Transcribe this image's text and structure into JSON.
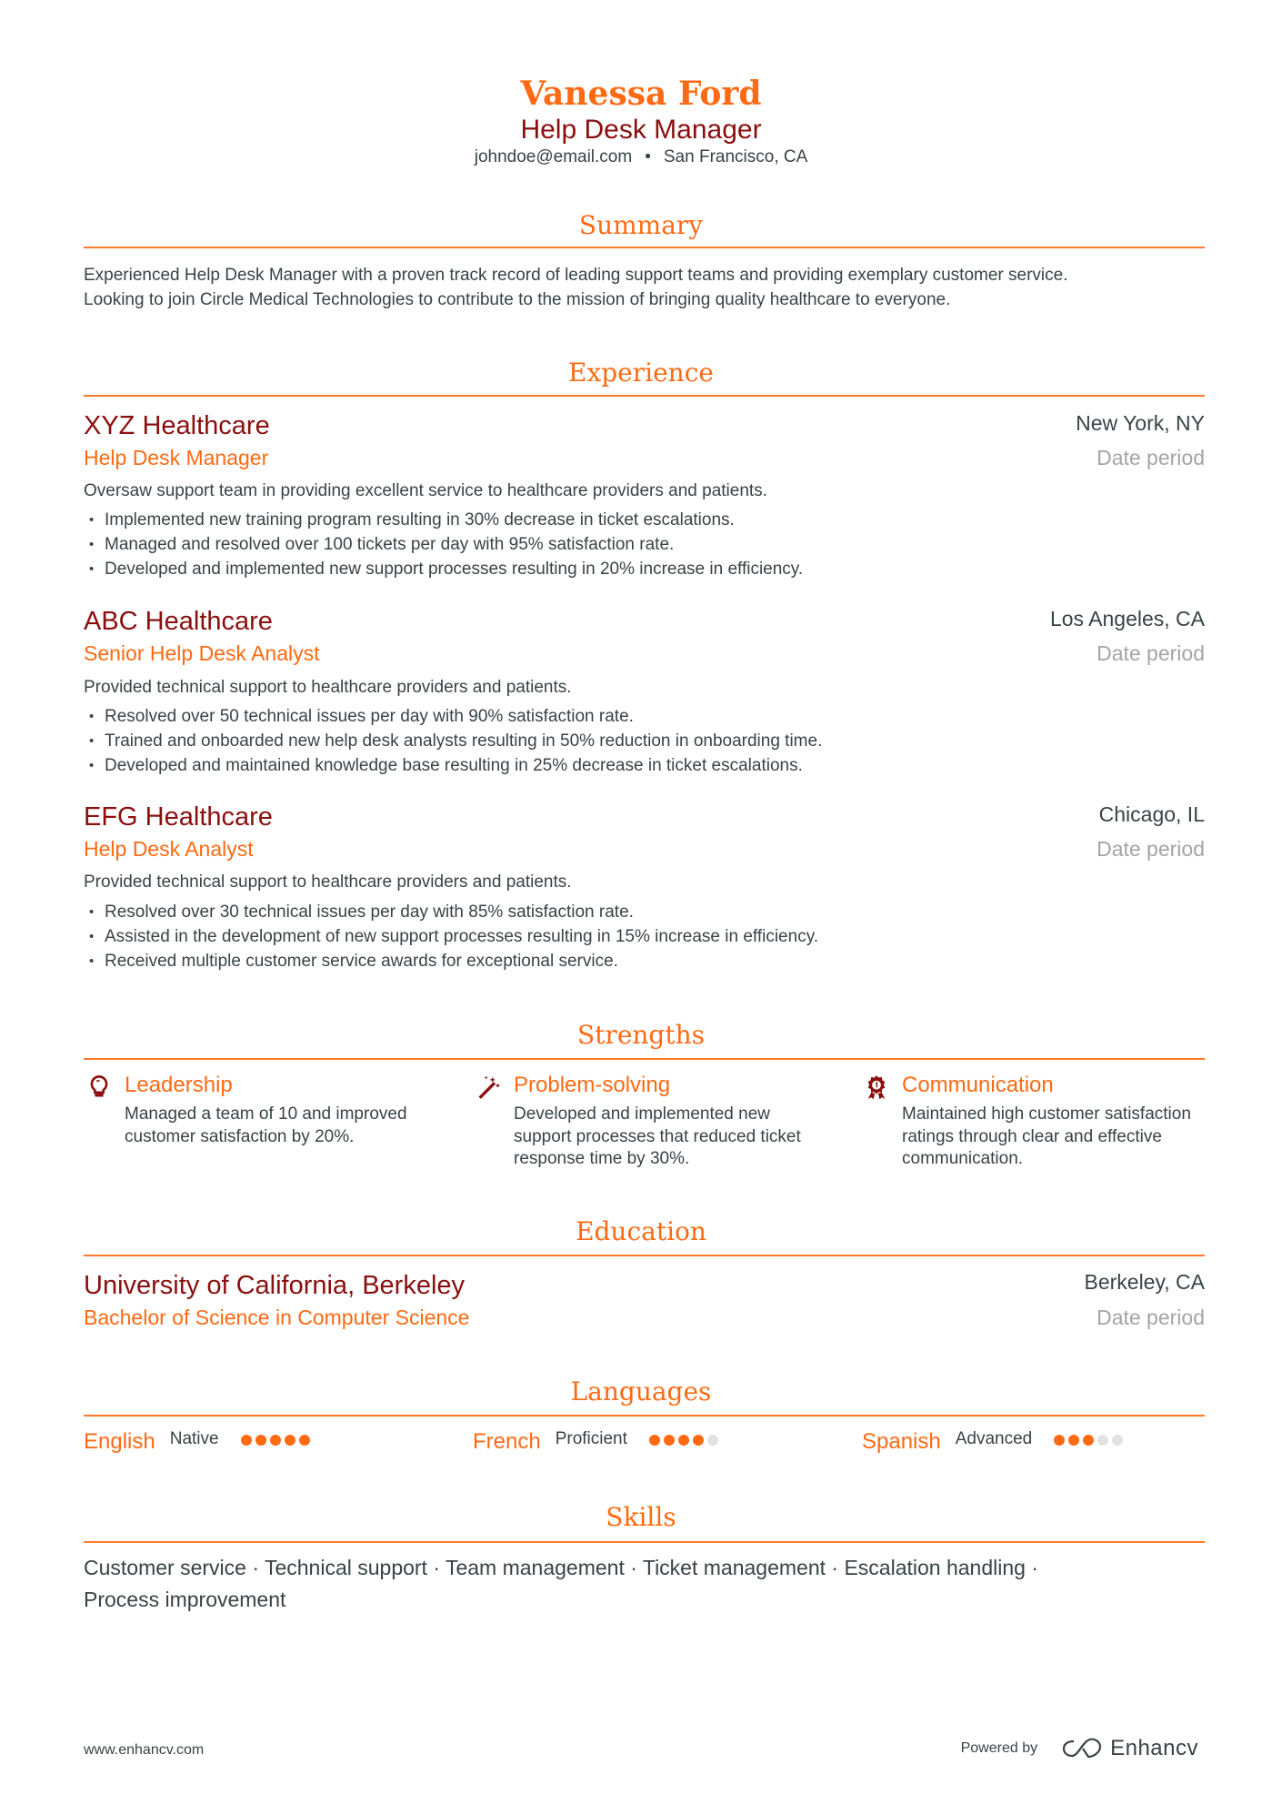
{
  "header": {
    "name": "Vanessa Ford",
    "title": "Help Desk Manager",
    "email": "johndoe@email.com",
    "separator": "•",
    "location": "San Francisco, CA"
  },
  "colors": {
    "accent": "#ff6a13",
    "secondary": "#8b0f0f",
    "text": "#384347",
    "muted": "#a4a4a4"
  },
  "summary": {
    "heading": "Summary",
    "lines": [
      "Experienced Help Desk Manager with a proven track record of leading support teams and providing exemplary customer service.",
      "Looking to join Circle Medical Technologies to contribute to the mission of bringing quality healthcare to everyone."
    ]
  },
  "experience": {
    "heading": "Experience",
    "items": [
      {
        "company": "XYZ Healthcare",
        "role": "Help Desk Manager",
        "location": "New York, NY",
        "date": "Date period",
        "description": "Oversaw support team in providing excellent service to healthcare providers and patients.",
        "bullets": [
          "Implemented new training program resulting in 30% decrease in ticket escalations.",
          "Managed and resolved over 100 tickets per day with 95% satisfaction rate.",
          "Developed and implemented new support processes resulting in 20% increase in efficiency."
        ]
      },
      {
        "company": "ABC Healthcare",
        "role": "Senior Help Desk Analyst",
        "location": "Los Angeles, CA",
        "date": "Date period",
        "description": "Provided technical support to healthcare providers and patients.",
        "bullets": [
          "Resolved over 50 technical issues per day with 90% satisfaction rate.",
          "Trained and onboarded new help desk analysts resulting in 50% reduction in onboarding time.",
          "Developed and maintained knowledge base resulting in 25% decrease in ticket escalations."
        ]
      },
      {
        "company": "EFG Healthcare",
        "role": "Help Desk Analyst",
        "location": "Chicago, IL",
        "date": "Date period",
        "description": "Provided technical support to healthcare providers and patients.",
        "bullets": [
          "Resolved over 30 technical issues per day with 85% satisfaction rate.",
          "Assisted in the development of new support processes resulting in 15% increase in efficiency.",
          "Received multiple customer service awards for exceptional service."
        ]
      }
    ]
  },
  "strengths": {
    "heading": "Strengths",
    "items": [
      {
        "icon": "lightbulb-icon",
        "title": "Leadership",
        "description": "Managed a team of 10 and improved customer satisfaction by 20%."
      },
      {
        "icon": "magic-wand-icon",
        "title": "Problem-solving",
        "description": "Developed and implemented new support processes that reduced ticket response time by 30%."
      },
      {
        "icon": "award-ribbon-icon",
        "title": "Communication",
        "description": "Maintained high customer satisfaction ratings through clear and effective communication."
      }
    ]
  },
  "education": {
    "heading": "Education",
    "items": [
      {
        "school": "University of California, Berkeley",
        "degree": "Bachelor of Science in Computer Science",
        "location": "Berkeley, CA",
        "date": "Date period"
      }
    ]
  },
  "languages": {
    "heading": "Languages",
    "items": [
      {
        "name": "English",
        "level": "Native",
        "rating": 5,
        "max": 5
      },
      {
        "name": "French",
        "level": "Proficient",
        "rating": 4,
        "max": 5
      },
      {
        "name": "Spanish",
        "level": "Advanced",
        "rating": 3,
        "max": 5
      }
    ]
  },
  "skills": {
    "heading": "Skills",
    "line1": "Customer service · Technical support · Team management · Ticket management · Escalation handling ·",
    "line2": "Process improvement"
  },
  "footer": {
    "website": "www.enhancv.com",
    "powered_by": "Powered by",
    "brand": "Enhancv"
  }
}
